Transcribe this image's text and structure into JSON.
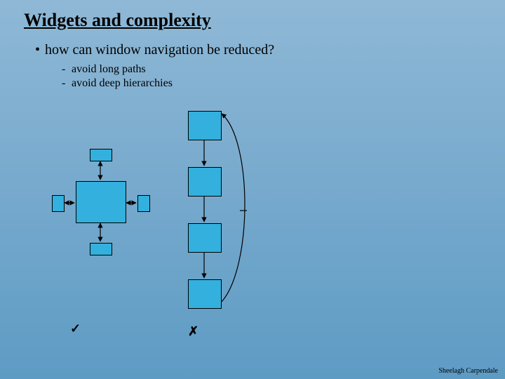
{
  "title": "Widgets and complexity",
  "bullet": "how can window navigation be reduced?",
  "sub1": "avoid long paths",
  "sub2": "avoid deep hierarchies",
  "mark_good": "✓",
  "mark_bad": "✗",
  "author": "Sheelagh Carpendale",
  "diagram": {
    "left": {
      "description": "hub-and-spoke navigation (shallow)",
      "center_box": "large",
      "outer_boxes": 4,
      "arrows": "bidirectional"
    },
    "right": {
      "description": "linear chain navigation (deep)",
      "boxes": 4,
      "arrows": "sequential with long back-arc"
    }
  }
}
